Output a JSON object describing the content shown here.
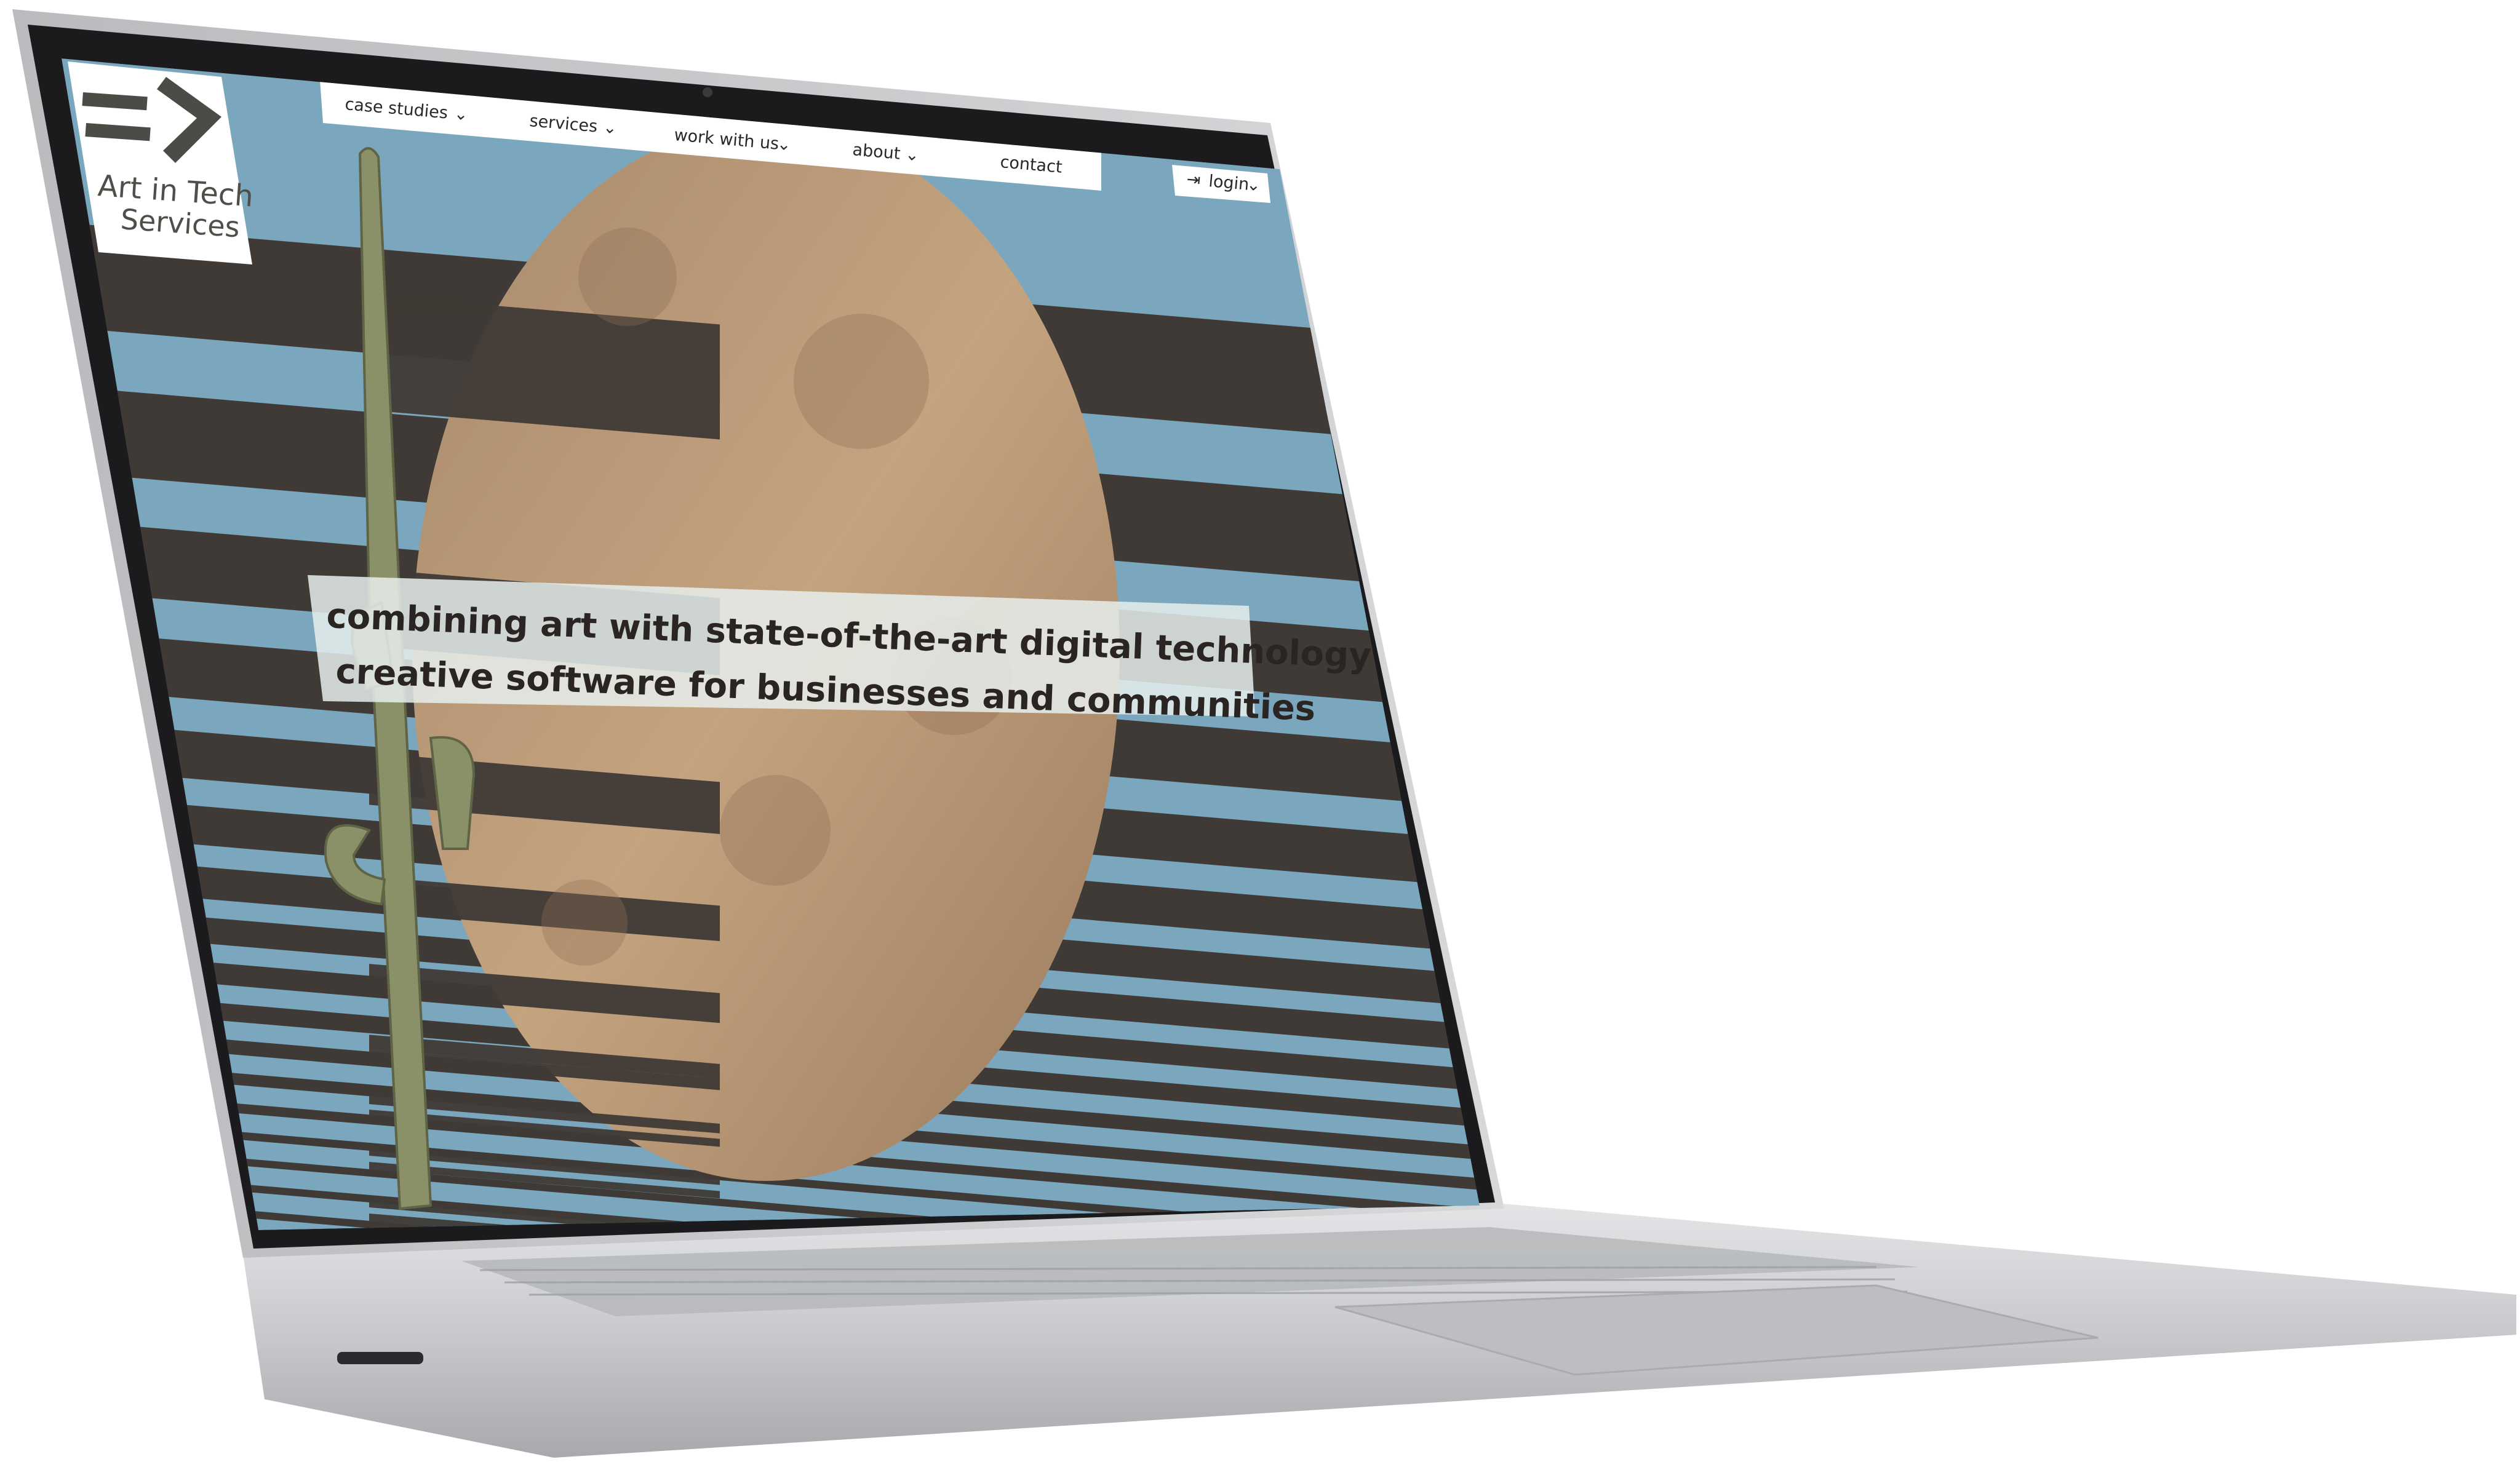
{
  "logo": {
    "glyph": "=>",
    "line1": "Art in Tech",
    "line2": "Services"
  },
  "nav": {
    "items": [
      {
        "label": "case studies",
        "has_dropdown": true
      },
      {
        "label": "services",
        "has_dropdown": true
      },
      {
        "label": "work with us",
        "has_dropdown": true
      },
      {
        "label": "about",
        "has_dropdown": true
      },
      {
        "label": "contact",
        "has_dropdown": false
      }
    ],
    "login_label": "login"
  },
  "hero": {
    "line1": "combining art with state-of-the-art digital technology to produce",
    "line2": "creative software for businesses and communities"
  },
  "colors": {
    "sky_blue": "#7aa7bd",
    "dark_band": "#403a36",
    "moon": "#b09070",
    "laptop_silver": "#c9cacc",
    "bezel": "#1c1c1e",
    "overlay": "#e6efec"
  }
}
